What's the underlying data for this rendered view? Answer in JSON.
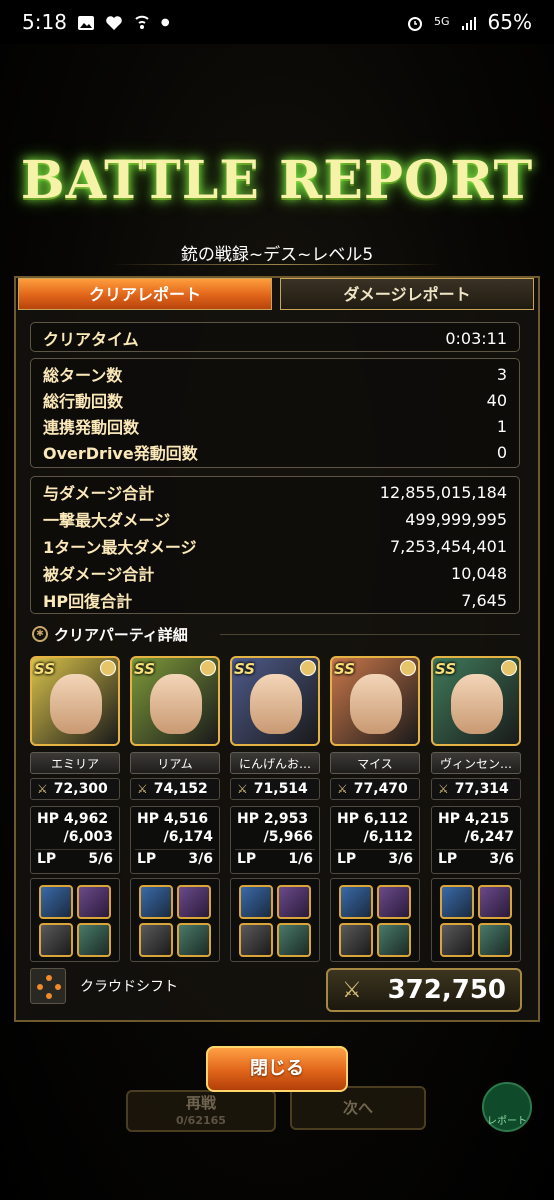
{
  "status_bar": {
    "time": "5:18",
    "network": "5G",
    "battery": "65%"
  },
  "header": {
    "title": "BATTLE REPORT",
    "subtitle": "銃の戦録~デス~レベル5"
  },
  "tabs": [
    {
      "label": "クリアレポート",
      "active": true
    },
    {
      "label": "ダメージレポート",
      "active": false
    }
  ],
  "clear_time": {
    "label": "クリアタイム",
    "value": "0:03:11"
  },
  "counts": [
    {
      "label": "総ターン数",
      "value": "3"
    },
    {
      "label": "総行動回数",
      "value": "40"
    },
    {
      "label": "連携発動回数",
      "value": "1"
    },
    {
      "label": "OverDrive発動回数",
      "value": "0"
    }
  ],
  "damage": [
    {
      "label": "与ダメージ合計",
      "value": "12,855,015,184"
    },
    {
      "label": "一撃最大ダメージ",
      "value": "499,999,995"
    },
    {
      "label": "1ターン最大ダメージ",
      "value": "7,253,454,401"
    },
    {
      "label": "被ダメージ合計",
      "value": "10,048"
    },
    {
      "label": "HP回復合計",
      "value": "7,645"
    }
  ],
  "party": {
    "heading": "クリアパーティ詳細",
    "members": [
      {
        "name": "エミリア",
        "power": "72,300",
        "hp": "4,962",
        "hp_max": "/6,003",
        "lp": "5/6",
        "badge": "SS",
        "color": "#d8c24a"
      },
      {
        "name": "リアム",
        "power": "74,152",
        "hp": "4,516",
        "hp_max": "/6,174",
        "lp": "3/6",
        "badge": "SS",
        "color": "#7e9a3a"
      },
      {
        "name": "にんげんお…",
        "power": "71,514",
        "hp": "2,953",
        "hp_max": "/5,966",
        "lp": "1/6",
        "badge": "SS",
        "color": "#4e5a8a"
      },
      {
        "name": "マイス",
        "power": "77,470",
        "hp": "6,112",
        "hp_max": "/6,112",
        "lp": "3/6",
        "badge": "SS",
        "color": "#c9774a"
      },
      {
        "name": "ヴィンセン…",
        "power": "77,314",
        "hp": "4,215",
        "hp_max": "/6,247",
        "lp": "3/6",
        "badge": "SS",
        "color": "#3f7a5a"
      }
    ]
  },
  "labels": {
    "hp": "HP",
    "lp": "LP"
  },
  "cloud_shift": {
    "label": "クラウドシフト"
  },
  "total_power": "372,750",
  "buttons": {
    "close": "閉じる",
    "retry": "再戦",
    "retry_sub": "0/62165",
    "next": "次へ",
    "report": "レポート"
  }
}
